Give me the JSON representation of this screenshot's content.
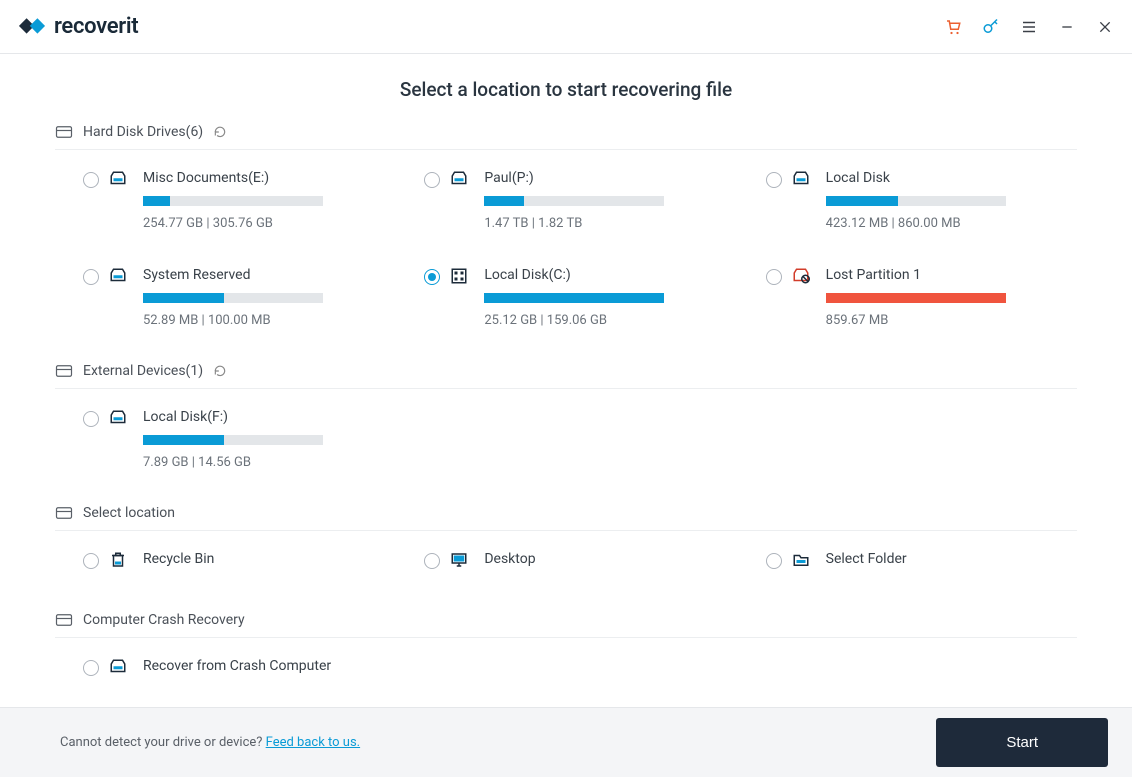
{
  "app": {
    "name": "recoverit"
  },
  "page_title": "Select a location to start recovering file",
  "sections": {
    "hdd": {
      "title": "Hard Disk Drives(6)"
    },
    "ext": {
      "title": "External Devices(1)"
    },
    "loc": {
      "title": "Select location"
    },
    "crash": {
      "title": "Computer Crash Recovery"
    }
  },
  "drives": {
    "hdd": [
      {
        "name": "Misc Documents(E:)",
        "size": "254.77  GB | 305.76  GB",
        "pct": 15,
        "color": "blue",
        "selected": false,
        "icon": "disk"
      },
      {
        "name": "Paul(P:)",
        "size": "1.47  TB | 1.82  TB",
        "pct": 22,
        "color": "blue",
        "selected": false,
        "icon": "disk"
      },
      {
        "name": "Local Disk",
        "size": "423.12  MB | 860.00  MB",
        "pct": 40,
        "color": "blue",
        "selected": false,
        "icon": "disk"
      },
      {
        "name": "System Reserved",
        "size": "52.89  MB | 100.00  MB",
        "pct": 45,
        "color": "blue",
        "selected": false,
        "icon": "disk"
      },
      {
        "name": "Local Disk(C:)",
        "size": "25.12  GB | 159.06  GB",
        "pct": 100,
        "color": "blue",
        "selected": true,
        "icon": "system"
      },
      {
        "name": "Lost Partition 1",
        "size": "859.67  MB",
        "pct": 100,
        "color": "red",
        "selected": false,
        "icon": "lost"
      }
    ],
    "ext": [
      {
        "name": "Local Disk(F:)",
        "size": "7.89  GB | 14.56  GB",
        "pct": 45,
        "color": "blue",
        "selected": false,
        "icon": "disk"
      }
    ],
    "loc": [
      {
        "name": "Recycle Bin",
        "icon": "bin"
      },
      {
        "name": "Desktop",
        "icon": "monitor"
      },
      {
        "name": "Select Folder",
        "icon": "folder"
      }
    ],
    "crash": [
      {
        "name": "Recover from Crash Computer",
        "icon": "disk"
      }
    ]
  },
  "footer": {
    "text": "Cannot detect your drive or device? ",
    "link": "Feed back to us.",
    "button": "Start"
  }
}
